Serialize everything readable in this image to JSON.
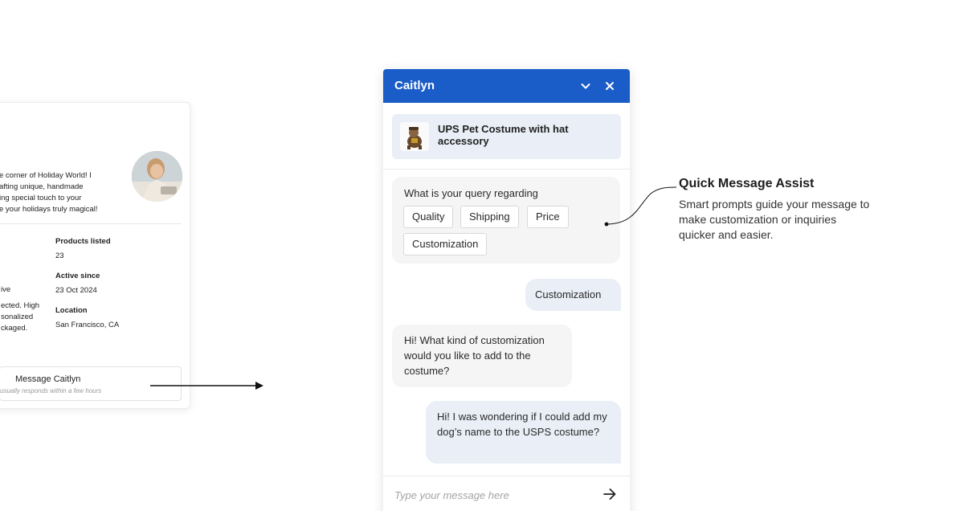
{
  "profile_card": {
    "bio": "e corner of Holiday World! I\nafting unique, handmade\ning  special touch to your\ne your holidays truly magical!",
    "products_listed_label": "Products listed",
    "products_listed_value": "23",
    "active_since_label": "Active since",
    "active_since_value": "23 Oct 2024",
    "location_label": "Location",
    "location_value": "San Francisco, CA",
    "left_fragment_1": "ive",
    "left_fragment_2": "ected. High\nsonalized\nckaged.",
    "message_button_label": "Message Caitlyn",
    "message_button_sub": "usually responds within a few hours"
  },
  "chat": {
    "title": "Caitlyn",
    "product_name": "UPS Pet Costume with hat accessory",
    "query_prompt": "What is your query regarding",
    "chips": [
      "Quality",
      "Shipping",
      "Price",
      "Customization"
    ],
    "messages": [
      {
        "from": "user",
        "text": "Customization"
      },
      {
        "from": "seller",
        "text": "Hi! What kind of customization would you like to add to the costume?"
      },
      {
        "from": "user",
        "text": "Hi! I was wondering if I could add my dog’s name to the USPS costume?"
      }
    ],
    "input_placeholder": "Type your message here"
  },
  "annotation": {
    "title": "Quick Message Assist",
    "description": "Smart prompts guide your message to make customization or inquiries quicker and easier."
  },
  "colors": {
    "header_blue": "#1a5cc8",
    "bubble_out": "#e9eef7",
    "bubble_in": "#f5f5f5"
  }
}
